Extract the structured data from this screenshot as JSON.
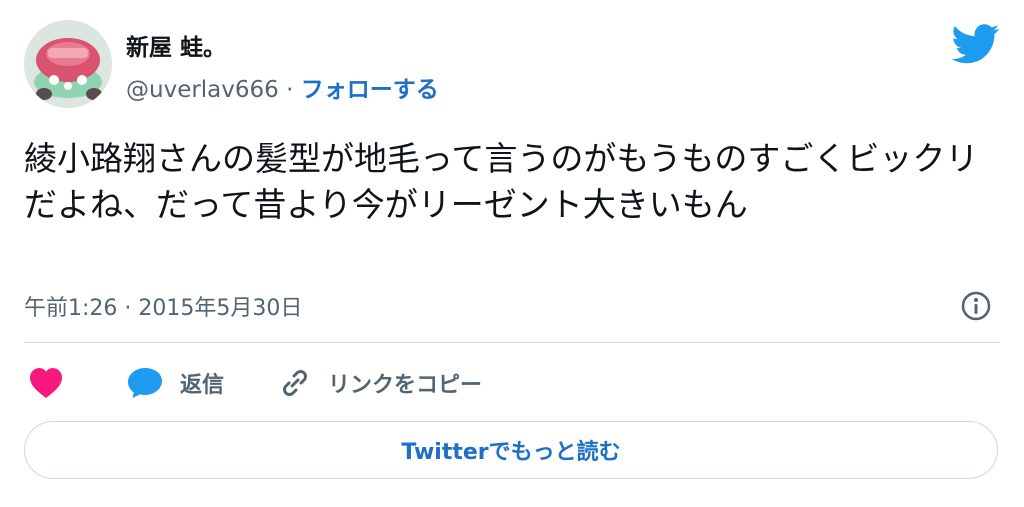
{
  "author": {
    "display_name": "新屋 蛙。",
    "handle": "@uverlav666",
    "separator": "·",
    "follow_label": "フォローする"
  },
  "tweet": {
    "text": "綾小路翔さんの髪型が地毛って言うのがもうものすごくビックリだよね、だって昔より今がリーゼント大きいもん",
    "timestamp": "午前1:26 · 2015年5月30日"
  },
  "actions": {
    "reply_label": "返信",
    "copy_link_label": "リンクをコピー"
  },
  "read_more_label": "Twitterでもっと読む",
  "colors": {
    "twitter_blue": "#1d9bf0",
    "link_blue": "#1d6fc8",
    "like_pink": "#f91880",
    "muted_gray": "#536471",
    "divider": "#cfd9de"
  },
  "icons": {
    "brand": "twitter-bird-icon",
    "info": "info-icon",
    "like": "heart-icon",
    "reply": "speech-bubble-icon",
    "copy": "link-icon"
  }
}
